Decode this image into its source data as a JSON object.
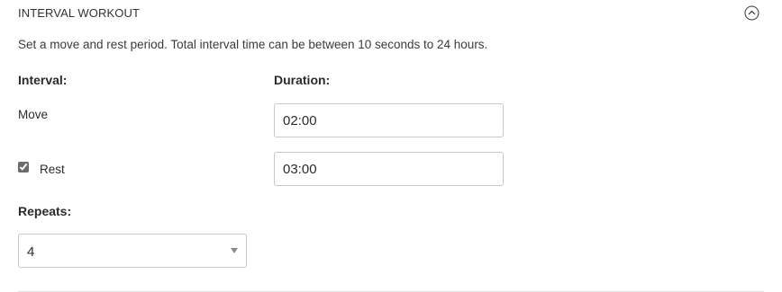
{
  "section": {
    "title": "INTERVAL WORKOUT",
    "toggle_icon": "chevron-up-circle-icon"
  },
  "description": "Set a move and rest period. Total interval time can be between 10 seconds to 24 hours.",
  "columns": {
    "interval": "Interval:",
    "duration": "Duration:"
  },
  "move": {
    "label": "Move",
    "duration": "02:00"
  },
  "rest": {
    "label": "Rest",
    "checked": true,
    "duration": "03:00"
  },
  "repeats": {
    "label": "Repeats:",
    "value": "4"
  },
  "colors": {
    "text": "#2b2b2b",
    "border": "#c8c8c8",
    "divider": "#e2e2e2"
  }
}
